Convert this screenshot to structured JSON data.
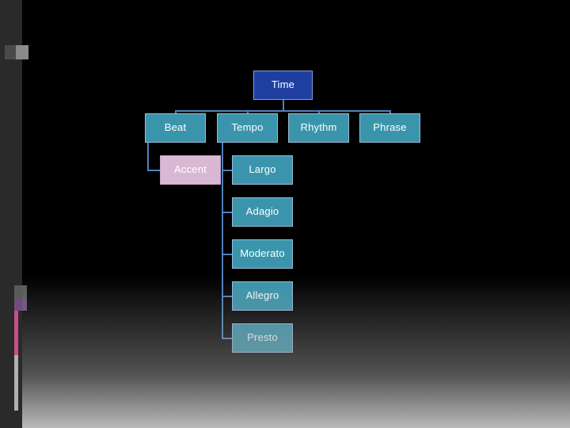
{
  "slide": {
    "background_color": "#000000",
    "accent_line_color": "#4f81bd"
  },
  "diagram": {
    "type": "hierarchy-tree",
    "title": "Time",
    "nodes": [
      {
        "id": "time",
        "label": "Time",
        "level": 0,
        "style": "root",
        "color": "#1f3fa0"
      },
      {
        "id": "beat",
        "label": "Beat",
        "level": 1,
        "style": "teal",
        "color": "#3a95ac"
      },
      {
        "id": "tempo",
        "label": "Tempo",
        "level": 1,
        "style": "teal",
        "color": "#3a95ac"
      },
      {
        "id": "rhythm",
        "label": "Rhythm",
        "level": 1,
        "style": "teal",
        "color": "#3a95ac"
      },
      {
        "id": "phrase",
        "label": "Phrase",
        "level": 1,
        "style": "teal",
        "color": "#3a95ac"
      },
      {
        "id": "accent",
        "label": "Accent",
        "level": 2,
        "style": "pink",
        "color": "#d9b8d6",
        "parent": "beat"
      },
      {
        "id": "largo",
        "label": "Largo",
        "level": 2,
        "style": "teal",
        "color": "#3a95ac",
        "parent": "tempo"
      },
      {
        "id": "adagio",
        "label": "Adagio",
        "level": 2,
        "style": "teal",
        "color": "#3a95ac",
        "parent": "tempo"
      },
      {
        "id": "moderato",
        "label": "Moderato",
        "level": 2,
        "style": "teal",
        "color": "#3a95ac",
        "parent": "tempo"
      },
      {
        "id": "allegro",
        "label": "Allegro",
        "level": 2,
        "style": "teal",
        "color": "#3a95ac",
        "parent": "tempo"
      },
      {
        "id": "presto",
        "label": "Presto",
        "level": 2,
        "style": "teal",
        "color": "#3a95ac",
        "parent": "tempo"
      }
    ]
  }
}
